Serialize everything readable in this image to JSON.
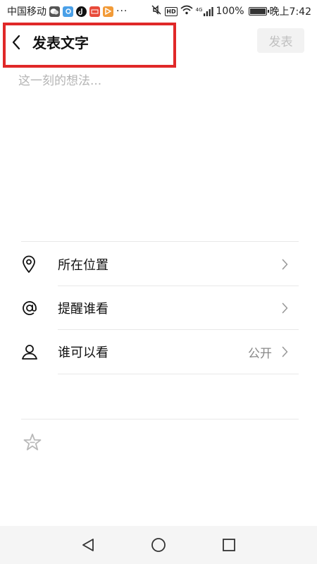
{
  "status_bar": {
    "carrier": "中国移动",
    "dots": "···",
    "battery": "100%",
    "battery_level": 1.0,
    "time": "晚上7:42",
    "signal": "4G",
    "hd_label": "HD"
  },
  "header": {
    "title": "发表文字",
    "publish_label": "发表"
  },
  "composer": {
    "placeholder": "这一刻的想法..."
  },
  "options": [
    {
      "label": "所在位置",
      "icon": "location-pin-icon",
      "value": ""
    },
    {
      "label": "提醒谁看",
      "icon": "at-icon",
      "value": ""
    },
    {
      "label": "谁可以看",
      "icon": "person-icon",
      "value": "公开"
    }
  ],
  "colors": {
    "highlight_border": "#e02828",
    "publish_bg": "#f2f2f2",
    "publish_text": "#c0c0c0",
    "placeholder": "#b4b4b4",
    "secondary_text": "#888888",
    "nav_bar_bg": "#f5f5f5"
  },
  "icons": {
    "back": "chevron-left-icon",
    "favorite": "star-icon",
    "nav_back": "triangle-back-icon",
    "nav_home": "circle-home-icon",
    "nav_recents": "square-recents-icon"
  }
}
